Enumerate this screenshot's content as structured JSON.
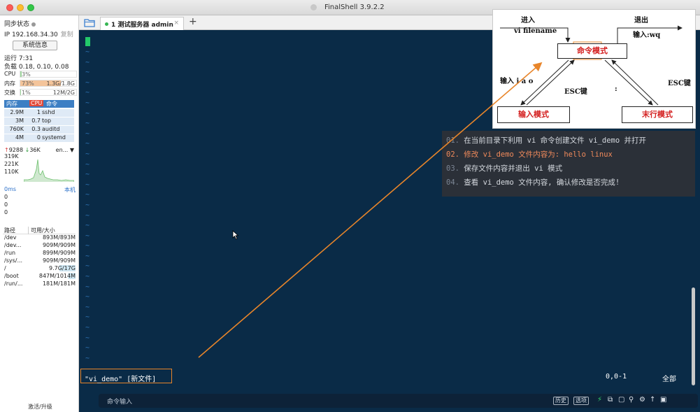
{
  "window": {
    "title": "FinalShell 3.9.2.2"
  },
  "sidebar": {
    "sync_status": "同步状态",
    "ip": "IP 192.168.34.30",
    "copy_label": "复制",
    "sysinfo_button": "系统信息",
    "uptime": "运行 7:31",
    "load": "负载 0.18, 0.10, 0.08",
    "cpu": {
      "label": "CPU",
      "percent_text": "3%",
      "fraction": 0.03
    },
    "memory": {
      "label": "内存",
      "percent_text": "73%",
      "fraction": 0.73,
      "used": "1.3G/1.8G"
    },
    "swap": {
      "label": "交换",
      "percent_text": "1%",
      "fraction": 0.01,
      "used": "12M/2G"
    },
    "process_headers": {
      "mem": "内存",
      "cpu": "CPU",
      "cmd": "命令"
    },
    "processes": [
      {
        "mem": "2.9M",
        "cpu": "1",
        "cmd": "sshd"
      },
      {
        "mem": "3M",
        "cpu": "0.7",
        "cmd": "top"
      },
      {
        "mem": "760K",
        "cpu": "0.3",
        "cmd": "auditd"
      },
      {
        "mem": "4M",
        "cpu": "0",
        "cmd": "systemd"
      }
    ],
    "net": {
      "up": "9288",
      "down": "36K",
      "iface": "en...",
      "levels": [
        "319K",
        "221K",
        "110K"
      ]
    },
    "latency": {
      "label": "0ms",
      "host": "本机",
      "values": [
        "0",
        "0",
        "0"
      ]
    },
    "fs_headers": {
      "path": "路径",
      "size": "可用/大小"
    },
    "filesystems": [
      {
        "path": "/dev",
        "size": "893M/893M"
      },
      {
        "path": "/dev...",
        "size": "909M/909M"
      },
      {
        "path": "/run",
        "size": "899M/909M"
      },
      {
        "path": "/sys/...",
        "size": "909M/909M"
      },
      {
        "path": "/",
        "size": "9.7G/17G"
      },
      {
        "path": "/boot",
        "size": "847M/1014M"
      },
      {
        "path": "/run/...",
        "size": "181M/181M"
      }
    ],
    "footer": "激活/升级"
  },
  "tabs": [
    {
      "label": "1 测试服务器 admin",
      "close": "×"
    }
  ],
  "tab_add": "+",
  "terminal": {
    "tilde": "~",
    "status_file": "\"vi_demo\" [新文件]",
    "status_pos": "0,0-1",
    "status_all": "全部"
  },
  "cmdbar": {
    "placeholder": "命令输入",
    "history_button": "历史",
    "options_button": "选项"
  },
  "tasks": [
    {
      "num": "01.",
      "text": "在当前目录下利用 vi 命令创建文件 vi_demo 并打开",
      "highlight": false
    },
    {
      "num": "02.",
      "text": "修改 vi_demo 文件内容为: hello linux",
      "highlight": true
    },
    {
      "num": "03.",
      "text": "保存文件内容并退出 vi 模式",
      "highlight": false
    },
    {
      "num": "04.",
      "text": "查看 vi_demo 文件内容, 确认修改是否完成!",
      "highlight": false
    }
  ],
  "diagram": {
    "enter_label": "进入",
    "enter_cmd": "vi filename",
    "exit_label": "退出",
    "exit_cmd": "输入:wq",
    "command_mode": "命令模式",
    "insert_keys": "输入 i a o",
    "esc_left": "ESC键",
    "colon": ":",
    "esc_right": "ESC键",
    "insert_mode": "输入模式",
    "last_line_mode": "末行模式"
  },
  "colors": {
    "terminal_bg": "#0a2b47",
    "accent_orange": "#e8852a",
    "highlight_task": "#f08a5b",
    "mode_red": "#d42020"
  }
}
